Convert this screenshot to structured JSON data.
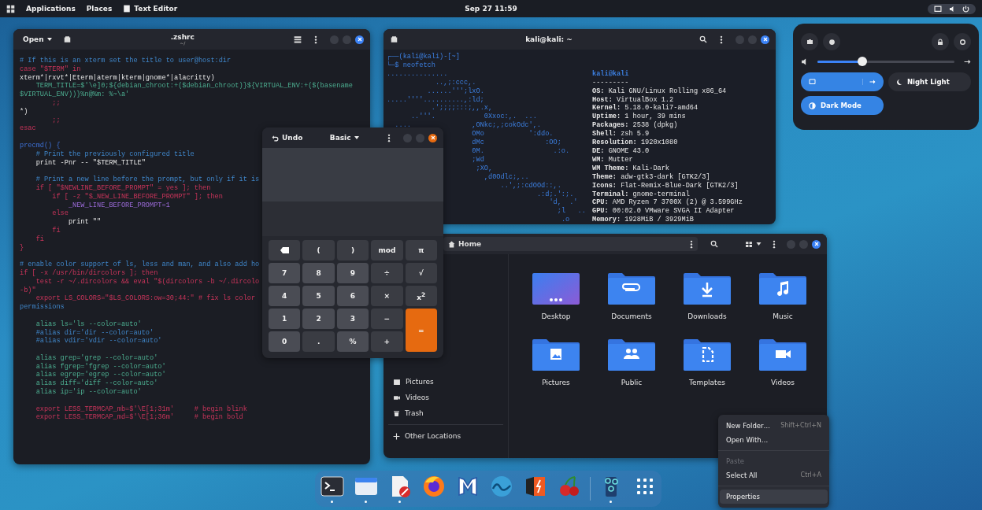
{
  "top_bar": {
    "menus": [
      "Applications",
      "Places"
    ],
    "app_name": "Text Editor",
    "clock": "Sep 27  11:59"
  },
  "editor": {
    "open_button": "Open",
    "title": ".zshrc",
    "subtitle": "~/",
    "lines": [
      {
        "text": "# If this is an xterm set the title to user@host:dir",
        "kind": "comment"
      },
      {
        "text": "case \"$TERM\" in",
        "kind": "keyword"
      },
      {
        "text": "xterm*|rxvt*|Eterm|aterm|kterm|gnome*|alacritty)",
        "kind": "plain"
      },
      {
        "text": "    TERM_TITLE=$'\\e]0;${debian_chroot:+($debian_chroot)}${VIRTUAL_ENV:+($(basename",
        "kind": "string"
      },
      {
        "text": "$VIRTUAL_ENV))}%n@%m: %~\\a'",
        "kind": "string"
      },
      {
        "text": "        ;;",
        "kind": "keyword"
      },
      {
        "text": "*)",
        "kind": "plain"
      },
      {
        "text": "        ;;",
        "kind": "keyword"
      },
      {
        "text": "esac",
        "kind": "keyword"
      },
      {
        "kind": "blank"
      },
      {
        "text": "precmd() {",
        "kind": "function"
      },
      {
        "text": "    # Print the previously configured title",
        "kind": "comment"
      },
      {
        "text": "    print -Pnr -- \"$TERM_TITLE\"",
        "kind": "plain"
      },
      {
        "kind": "blank"
      },
      {
        "text": "    # Print a new line before the prompt, but only if it is",
        "kind": "comment"
      },
      {
        "text": "    if [ \"$NEWLINE_BEFORE_PROMPT\" = yes ]; then",
        "kind": "keyword"
      },
      {
        "text": "        if [ -z \"$_NEW_LINE_BEFORE_PROMPT\" ]; then",
        "kind": "keyword"
      },
      {
        "text": "            _NEW_LINE_BEFORE_PROMPT=1",
        "kind": "variable"
      },
      {
        "text": "        else",
        "kind": "keyword"
      },
      {
        "text": "            print \"\"",
        "kind": "plain"
      },
      {
        "text": "        fi",
        "kind": "keyword"
      },
      {
        "text": "    fi",
        "kind": "keyword"
      },
      {
        "text": "}",
        "kind": "keyword"
      },
      {
        "kind": "blank"
      },
      {
        "text": "# enable color support of ls, less and man, and also add ho",
        "kind": "comment"
      },
      {
        "text": "if [ -x /usr/bin/dircolors ]; then",
        "kind": "keyword"
      },
      {
        "text": "    test -r ~/.dircolors && eval \"$(dircolors -b ~/.dircolo",
        "kind": "keyword"
      },
      {
        "text": "-b)\"",
        "kind": "keyword"
      },
      {
        "text": "    export LS_COLORS=\"$LS_COLORS:ow=30;44:\" # fix ls color",
        "kind": "keyword"
      },
      {
        "text": "permissions",
        "kind": "comment"
      },
      {
        "kind": "blank"
      },
      {
        "text": "    alias ls='ls --color=auto'",
        "kind": "string"
      },
      {
        "text": "    #alias dir='dir --color=auto'",
        "kind": "comment"
      },
      {
        "text": "    #alias vdir='vdir --color=auto'",
        "kind": "comment"
      },
      {
        "kind": "blank"
      },
      {
        "text": "    alias grep='grep --color=auto'",
        "kind": "string"
      },
      {
        "text": "    alias fgrep='fgrep --color=auto'",
        "kind": "string"
      },
      {
        "text": "    alias egrep='egrep --color=auto'",
        "kind": "string"
      },
      {
        "text": "    alias diff='diff --color=auto'",
        "kind": "string"
      },
      {
        "text": "    alias ip='ip --color=auto'",
        "kind": "string"
      },
      {
        "kind": "blank"
      },
      {
        "text": "    export LESS_TERMCAP_mb=$'\\E[1;31m'     # begin blink",
        "kind": "keyword"
      },
      {
        "text": "    export LESS_TERMCAP_md=$'\\E[1;36m'     # begin bold",
        "kind": "keyword"
      }
    ]
  },
  "terminal": {
    "title": "kali@kali: ~",
    "prompt": "┌──(kali@kali)-[~]",
    "command": "└─$ neofetch",
    "art": [
      "...............",
      "            ..,;:ccc,.",
      "          ......''';lxO.",
      ".....''''..........,:ld;",
      "           .';;;;:::;,,.x,",
      "      ..'''.            0Xxoc:,.  ...",
      "  ....               ,ONkc;,;cokOdc',.",
      "                     OMo           ':ddo.",
      "                     dMc               :OO;",
      "                     0M.                 .:o.",
      "                     ;Wd",
      "                      ;XO,",
      "                        ,d0Odlc;,..",
      "                            ..',;:cdOOd::,.",
      "                                     .:d;.':;.",
      "                                        'd,  .'",
      "                                          ;l   ..",
      "                                           .o"
    ],
    "info_title": "kali@kali",
    "info_rule": "---------",
    "info": [
      {
        "key": "OS:",
        "value": "Kali GNU/Linux Rolling x86_64"
      },
      {
        "key": "Host:",
        "value": "VirtualBox 1.2"
      },
      {
        "key": "Kernel:",
        "value": "5.18.0-kali7-amd64"
      },
      {
        "key": "Uptime:",
        "value": "1 hour, 39 mins"
      },
      {
        "key": "Packages:",
        "value": "2538 (dpkg)"
      },
      {
        "key": "Shell:",
        "value": "zsh 5.9"
      },
      {
        "key": "Resolution:",
        "value": "1920x1080"
      },
      {
        "key": "DE:",
        "value": "GNOME 43.0"
      },
      {
        "key": "WM:",
        "value": "Mutter"
      },
      {
        "key": "WM Theme:",
        "value": "Kali-Dark"
      },
      {
        "key": "Theme:",
        "value": "adw-gtk3-dark [GTK2/3]"
      },
      {
        "key": "Icons:",
        "value": "Flat-Remix-Blue-Dark [GTK2/3]"
      },
      {
        "key": "Terminal:",
        "value": "gnome-terminal"
      },
      {
        "key": "CPU:",
        "value": "AMD Ryzen 7 3700X (2) @ 3.599GHz"
      },
      {
        "key": "GPU:",
        "value": "00:02.0 VMware SVGA II Adapter"
      },
      {
        "key": "Memory:",
        "value": "1928MiB / 3929MiB"
      }
    ]
  },
  "calculator": {
    "undo": "Undo",
    "mode": "Basic",
    "keys": [
      {
        "kind": "backspace"
      },
      {
        "label": "(",
        "kind": "op"
      },
      {
        "label": ")",
        "kind": "op"
      },
      {
        "label": "mod",
        "kind": "op"
      },
      {
        "label": "π",
        "kind": "op"
      },
      {
        "label": "7",
        "kind": "digit"
      },
      {
        "label": "8",
        "kind": "digit"
      },
      {
        "label": "9",
        "kind": "digit"
      },
      {
        "label": "÷",
        "kind": "op"
      },
      {
        "label": "√",
        "kind": "op"
      },
      {
        "label": "4",
        "kind": "digit"
      },
      {
        "label": "5",
        "kind": "digit"
      },
      {
        "label": "6",
        "kind": "digit"
      },
      {
        "label": "×",
        "kind": "op"
      },
      {
        "label": "x$^{2}$",
        "kind": "op"
      },
      {
        "label": "1",
        "kind": "digit"
      },
      {
        "label": "2",
        "kind": "digit"
      },
      {
        "label": "3",
        "kind": "digit"
      },
      {
        "label": "−",
        "kind": "op"
      },
      {
        "label": "=",
        "kind": "equals"
      },
      {
        "label": "0",
        "kind": "digit"
      },
      {
        "label": ".",
        "kind": "op"
      },
      {
        "label": "%",
        "kind": "digit"
      },
      {
        "label": "+",
        "kind": "op"
      }
    ]
  },
  "files": {
    "path": "Home",
    "sidebar": [
      {
        "label": "Pictures",
        "kind": "pictures"
      },
      {
        "label": "Videos",
        "kind": "videos"
      },
      {
        "label": "Trash",
        "kind": "trash"
      },
      {
        "label": "Other Locations",
        "kind": "other"
      }
    ],
    "folders": [
      {
        "label": "Desktop",
        "kind": "desktop"
      },
      {
        "label": "Documents",
        "kind": "documents"
      },
      {
        "label": "Downloads",
        "kind": "downloads"
      },
      {
        "label": "Music",
        "kind": "music"
      },
      {
        "label": "Pictures",
        "kind": "pictures"
      },
      {
        "label": "Public",
        "kind": "public"
      },
      {
        "label": "Templates",
        "kind": "templates"
      },
      {
        "label": "Videos",
        "kind": "videos"
      }
    ]
  },
  "context_menu": [
    {
      "label": "New Folder…",
      "shortcut": "Shift+Ctrl+N",
      "disabled": false,
      "selected": false
    },
    {
      "label": "Open With…",
      "disabled": false,
      "selected": false
    },
    {
      "kind": "separator"
    },
    {
      "label": "Paste",
      "disabled": true,
      "selected": false
    },
    {
      "label": "Select All",
      "shortcut": "Ctrl+A",
      "disabled": false,
      "selected": false
    },
    {
      "kind": "separator"
    },
    {
      "label": "Properties",
      "disabled": false,
      "selected": true
    }
  ],
  "quick_settings": {
    "volume": {
      "level": 0.33
    },
    "toggles": [
      {
        "kind": "display",
        "on": true
      },
      {
        "kind": "night",
        "label": "Night Light",
        "on": false
      },
      {
        "kind": "dark",
        "label": "Dark Mode",
        "on": true
      }
    ]
  },
  "dock": [
    {
      "kind": "terminal",
      "running": true
    },
    {
      "kind": "files",
      "running": true
    },
    {
      "kind": "editor",
      "running": true
    },
    {
      "kind": "firefox",
      "running": false
    },
    {
      "kind": "metasploit",
      "running": false
    },
    {
      "kind": "shark",
      "running": false
    },
    {
      "kind": "burp",
      "running": false
    },
    {
      "kind": "cherry",
      "running": false
    },
    {
      "kind": "separator"
    },
    {
      "kind": "nodes",
      "running": true
    },
    {
      "kind": "grid",
      "running": false
    }
  ]
}
